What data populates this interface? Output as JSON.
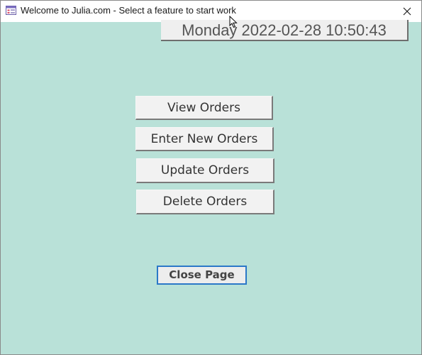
{
  "window": {
    "title": "Welcome to Julia.com - Select a feature to start work",
    "app_icon": "form-window-icon",
    "close_icon": "close-icon",
    "background_color": "#b9e1d8"
  },
  "header": {
    "datetime": "Monday 2022-02-28 10:50:43"
  },
  "menu": {
    "view_orders": "View Orders",
    "enter_new_orders": "Enter New Orders",
    "update_orders": "Update Orders",
    "delete_orders": "Delete Orders"
  },
  "footer": {
    "close_page": "Close Page"
  },
  "colors": {
    "focus_border": "#2b78c8",
    "button_face": "#f2f2f2"
  }
}
